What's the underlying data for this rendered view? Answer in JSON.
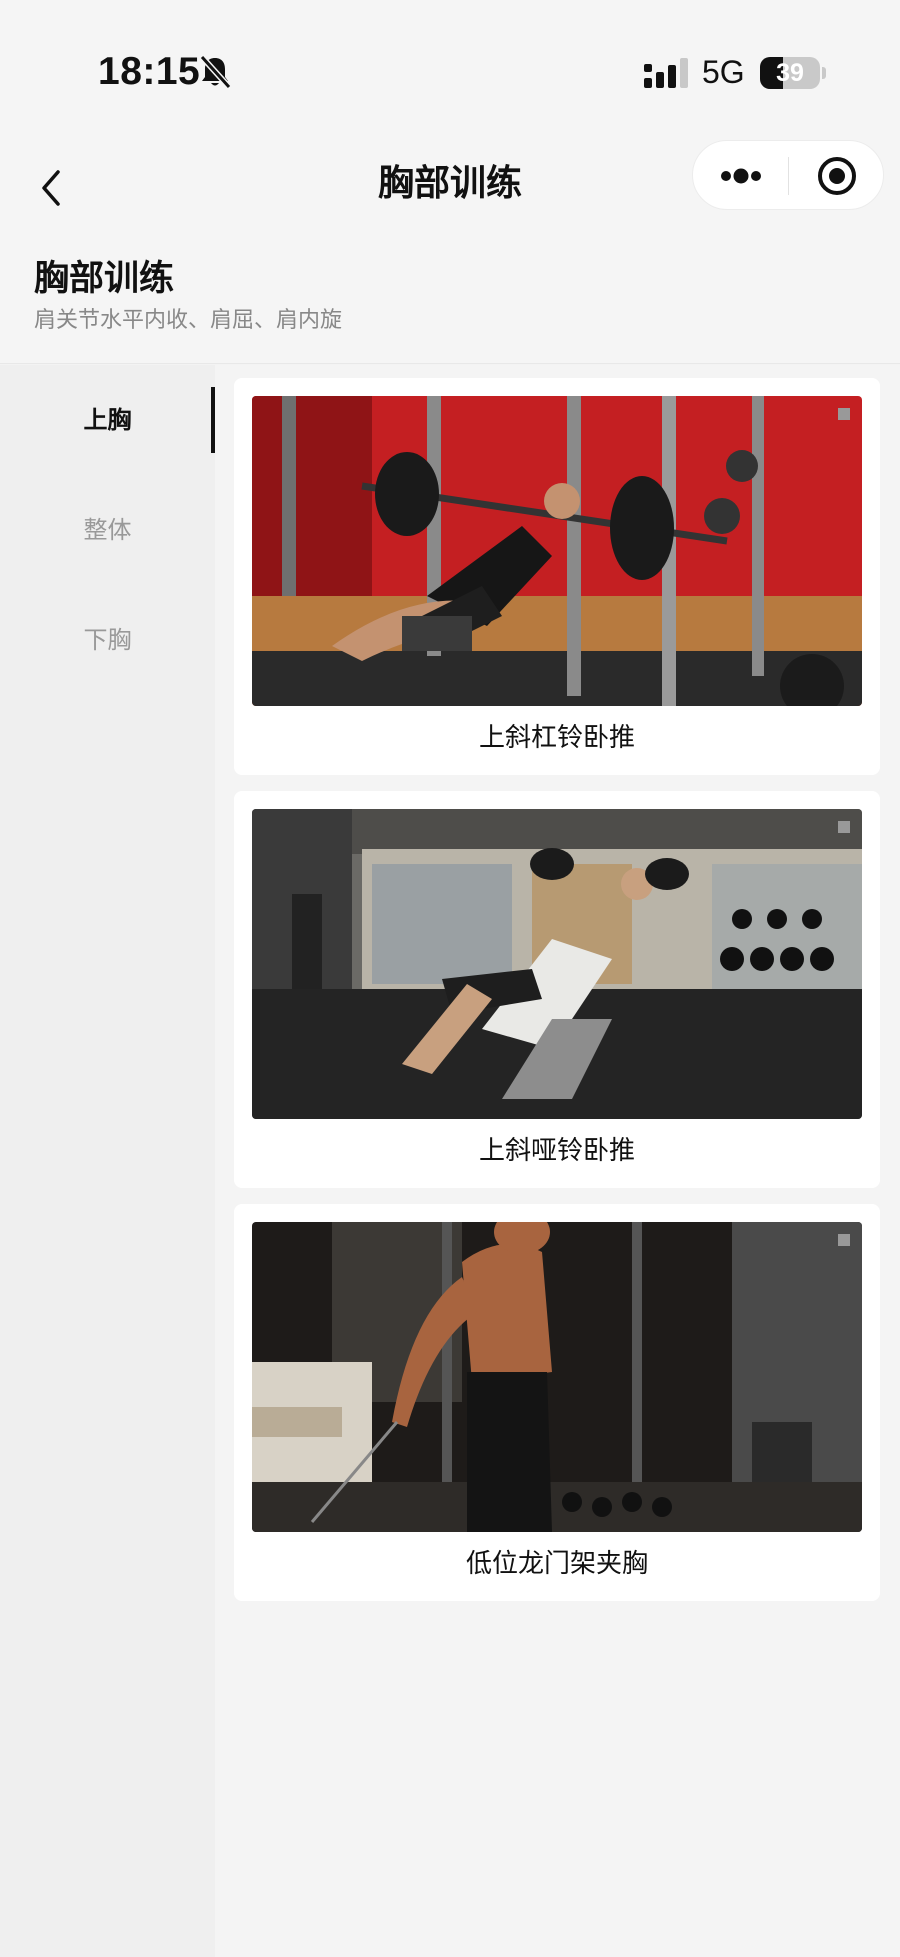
{
  "status_bar": {
    "time": "18:15",
    "network": "5G",
    "battery_level": "39",
    "battery_fraction": 0.39
  },
  "nav": {
    "title": "胸部训练",
    "back_icon": "chevron-left-icon",
    "more_icon": "more-dots-icon",
    "close_icon": "target-close-icon"
  },
  "header": {
    "title": "胸部训练",
    "subtitle": "肩关节水平内收、肩屈、肩内旋"
  },
  "sidebar": {
    "items": [
      {
        "label": "上胸",
        "active": true
      },
      {
        "label": "整体",
        "active": false
      },
      {
        "label": "下胸",
        "active": false
      }
    ]
  },
  "exercises": [
    {
      "label": "上斜杠铃卧推"
    },
    {
      "label": "上斜哑铃卧推"
    },
    {
      "label": "低位龙门架夹胸"
    }
  ],
  "colors": {
    "accent": "#111111",
    "inactive_text": "#999999",
    "subtitle": "#888888",
    "background": "#f3f3f3"
  }
}
